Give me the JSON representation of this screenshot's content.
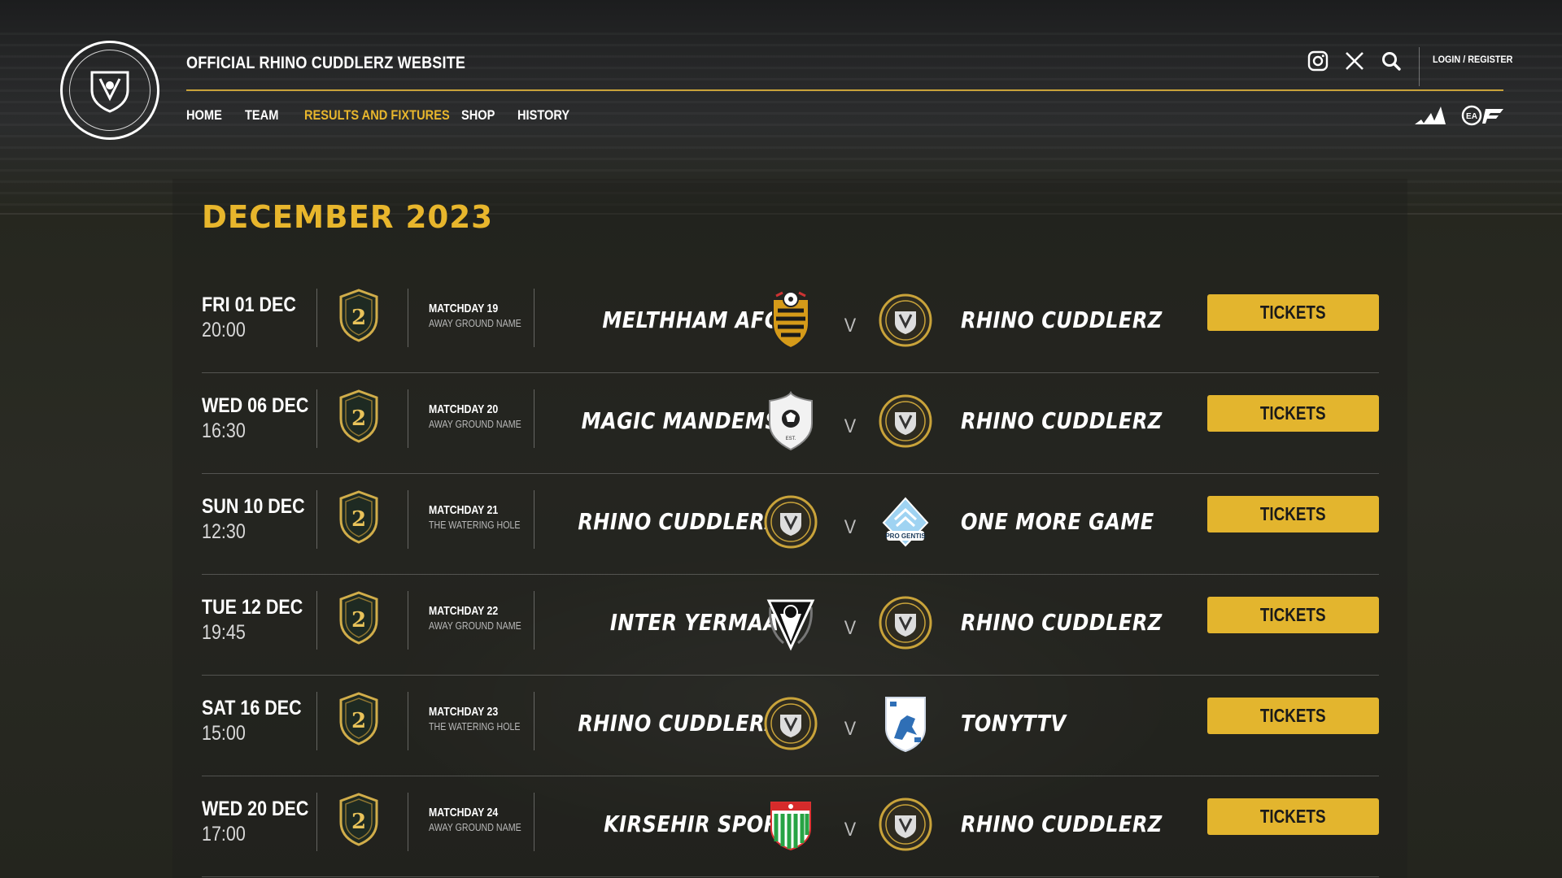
{
  "header": {
    "site_title": "OFFICIAL RHINO CUDDLERZ WEBSITE",
    "nav": [
      {
        "label": "HOME",
        "active": false
      },
      {
        "label": "TEAM",
        "active": false
      },
      {
        "label": "RESULTS AND FIXTURES",
        "active": true
      },
      {
        "label": "SHOP",
        "active": false
      },
      {
        "label": "HISTORY",
        "active": false
      }
    ],
    "icons": [
      "instagram-icon",
      "x-icon",
      "search-icon"
    ],
    "login_label": "LOGIN / REGISTER",
    "sponsors": [
      "adidas-logo",
      "ea-sports-fc-logo"
    ]
  },
  "colors": {
    "accent": "#e8b62c",
    "button": "#e3b52e",
    "divider": "#c9a33a"
  },
  "month_title": "DECEMBER 2023",
  "fixtures": [
    {
      "day": "FRI 01 DEC",
      "time": "20:00",
      "matchday": "MATCHDAY 19",
      "venue": "AWAY GROUND NAME",
      "home": "MELTHHAM AFC",
      "away": "RHINO CUDDLERZ",
      "home_logo": "wasp-crest",
      "away_logo": "rhino-crest",
      "vs": "V",
      "tickets": "TICKETS"
    },
    {
      "day": "WED 06 DEC",
      "time": "16:30",
      "matchday": "MATCHDAY 20",
      "venue": "AWAY GROUND NAME",
      "home": "MAGIC MANDEMS",
      "away": "RHINO CUDDLERZ",
      "home_logo": "ball-shield-crest",
      "away_logo": "rhino-crest",
      "vs": "V",
      "tickets": "TICKETS"
    },
    {
      "day": "SUN 10 DEC",
      "time": "12:30",
      "matchday": "MATCHDAY 21",
      "venue": "THE WATERING HOLE",
      "home": "RHINO CUDDLERZ",
      "away": "ONE MORE GAME",
      "home_logo": "rhino-crest",
      "away_logo": "pro-gentis-crest",
      "vs": "V",
      "tickets": "TICKETS"
    },
    {
      "day": "TUE 12 DEC",
      "time": "19:45",
      "matchday": "MATCHDAY 22",
      "venue": "AWAY GROUND NAME",
      "home": "INTER YERMAA",
      "away": "RHINO CUDDLERZ",
      "home_logo": "triangle-crest",
      "away_logo": "rhino-crest",
      "vs": "V",
      "tickets": "TICKETS"
    },
    {
      "day": "SAT 16 DEC",
      "time": "15:00",
      "matchday": "MATCHDAY 23",
      "venue": "THE WATERING HOLE",
      "home": "RHINO CUDDLERZ",
      "away": "TONYTTV",
      "home_logo": "rhino-crest",
      "away_logo": "lion-shield-crest",
      "vs": "V",
      "tickets": "TICKETS"
    },
    {
      "day": "WED 20 DEC",
      "time": "17:00",
      "matchday": "MATCHDAY 24",
      "venue": "AWAY GROUND NAME",
      "home": "KIRSEHIR SPOR",
      "away": "RHINO CUDDLERZ",
      "home_logo": "green-stripe-crest",
      "away_logo": "rhino-crest",
      "vs": "V",
      "tickets": "TICKETS"
    }
  ]
}
